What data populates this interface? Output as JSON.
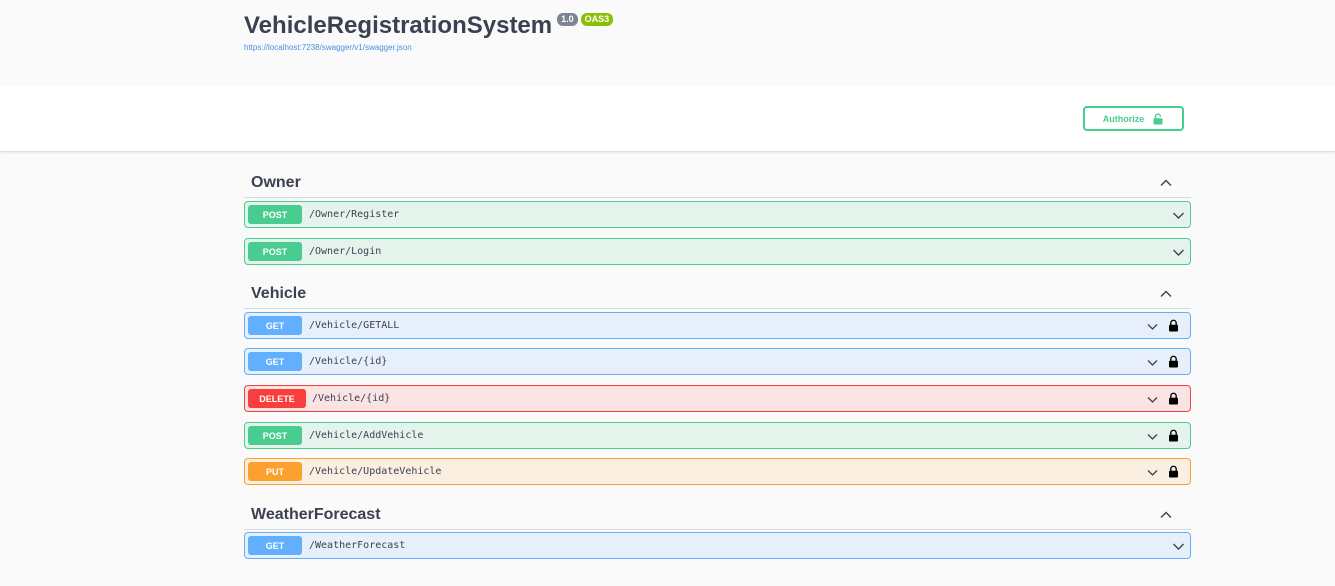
{
  "info": {
    "title": "VehicleRegistrationSystem",
    "version": "1.0",
    "oas": "OAS3",
    "spec_url": "https://localhost:7238/swagger/v1/swagger.json"
  },
  "scheme": {
    "authorize_label": "Authorize"
  },
  "tags": [
    {
      "name": "Owner",
      "operations": [
        {
          "method": "POST",
          "path": "/Owner/Register",
          "locked": false
        },
        {
          "method": "POST",
          "path": "/Owner/Login",
          "locked": false
        }
      ]
    },
    {
      "name": "Vehicle",
      "operations": [
        {
          "method": "GET",
          "path": "/Vehicle/GETALL",
          "locked": true
        },
        {
          "method": "GET",
          "path": "/Vehicle/{id}",
          "locked": true
        },
        {
          "method": "DELETE",
          "path": "/Vehicle/{id}",
          "locked": true
        },
        {
          "method": "POST",
          "path": "/Vehicle/AddVehicle",
          "locked": true
        },
        {
          "method": "PUT",
          "path": "/Vehicle/UpdateVehicle",
          "locked": true
        }
      ]
    },
    {
      "name": "WeatherForecast",
      "operations": [
        {
          "method": "GET",
          "path": "/WeatherForecast",
          "locked": false
        }
      ]
    }
  ],
  "colors": {
    "post": "#49cc90",
    "get": "#61affe",
    "delete": "#f93e3e",
    "put": "#fca130",
    "badge_version": "#7d8492",
    "badge_oas": "#89bf04",
    "link": "#4990e2"
  }
}
